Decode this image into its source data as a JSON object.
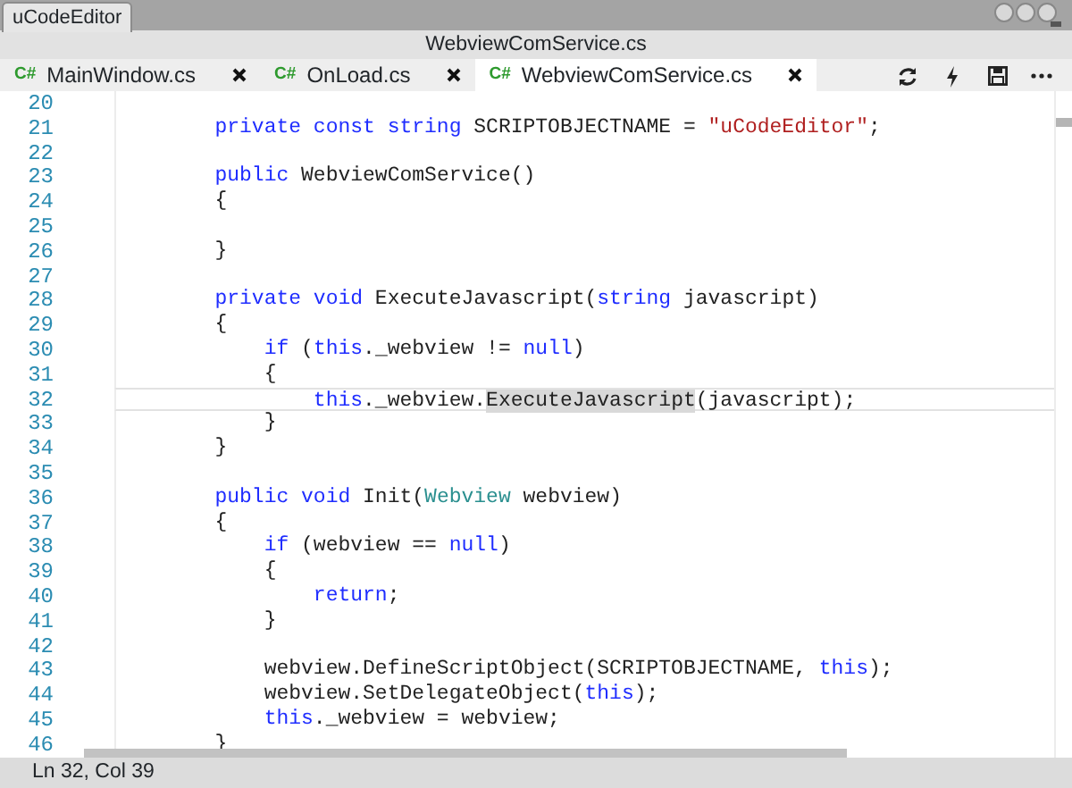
{
  "window": {
    "app_tab": "uCodeEditor",
    "title": "WebviewComService.cs"
  },
  "tabs": [
    {
      "badge": "C#",
      "label": "MainWindow.cs",
      "selected": false
    },
    {
      "badge": "C#",
      "label": "OnLoad.cs",
      "selected": false
    },
    {
      "badge": "C#",
      "label": "WebviewComService.cs",
      "selected": true
    }
  ],
  "editor": {
    "lines": [
      {
        "number": "20",
        "current": false
      },
      {
        "number": "21",
        "current": false,
        "tokens": [
          {
            "kind": "keyword",
            "text": "        private const string"
          },
          {
            "kind": "plain",
            "text": " SCRIPTOBJECTNAME = "
          },
          {
            "kind": "string",
            "text": "\"uCodeEditor\""
          },
          {
            "kind": "plain",
            "text": ";"
          }
        ]
      },
      {
        "number": "22",
        "current": false
      },
      {
        "number": "23",
        "current": false,
        "tokens": [
          {
            "kind": "keyword",
            "text": "        public"
          },
          {
            "kind": "plain",
            "text": " WebviewComService()"
          }
        ]
      },
      {
        "number": "24",
        "current": false,
        "tokens": [
          {
            "kind": "plain",
            "text": "        {"
          }
        ]
      },
      {
        "number": "25",
        "current": false
      },
      {
        "number": "26",
        "current": false,
        "tokens": [
          {
            "kind": "plain",
            "text": "        }"
          }
        ]
      },
      {
        "number": "27",
        "current": false
      },
      {
        "number": "28",
        "current": false,
        "tokens": [
          {
            "kind": "keyword",
            "text": "        private void"
          },
          {
            "kind": "plain",
            "text": " ExecuteJavascript("
          },
          {
            "kind": "keyword",
            "text": "string"
          },
          {
            "kind": "plain",
            "text": " javascript)"
          }
        ]
      },
      {
        "number": "29",
        "current": false,
        "tokens": [
          {
            "kind": "plain",
            "text": "        {"
          }
        ]
      },
      {
        "number": "30",
        "current": false,
        "tokens": [
          {
            "kind": "keyword",
            "text": "            if"
          },
          {
            "kind": "plain",
            "text": " ("
          },
          {
            "kind": "keyword",
            "text": "this"
          },
          {
            "kind": "plain",
            "text": "._webview != "
          },
          {
            "kind": "keyword",
            "text": "null"
          },
          {
            "kind": "plain",
            "text": ")"
          }
        ]
      },
      {
        "number": "31",
        "current": false,
        "tokens": [
          {
            "kind": "plain",
            "text": "            {"
          }
        ]
      },
      {
        "number": "32",
        "current": true,
        "tokens": [
          {
            "kind": "keyword",
            "text": "                this"
          },
          {
            "kind": "plain",
            "text": "._webview."
          },
          {
            "kind": "highlight",
            "text": "ExecuteJavascript"
          },
          {
            "kind": "plain",
            "text": "(javascript);"
          }
        ]
      },
      {
        "number": "33",
        "current": false,
        "tokens": [
          {
            "kind": "plain",
            "text": "            }"
          }
        ]
      },
      {
        "number": "34",
        "current": false,
        "tokens": [
          {
            "kind": "plain",
            "text": "        }"
          }
        ]
      },
      {
        "number": "35",
        "current": false
      },
      {
        "number": "36",
        "current": false,
        "tokens": [
          {
            "kind": "keyword",
            "text": "        public void"
          },
          {
            "kind": "plain",
            "text": " Init("
          },
          {
            "kind": "type",
            "text": "Webview"
          },
          {
            "kind": "plain",
            "text": " webview)"
          }
        ]
      },
      {
        "number": "37",
        "current": false,
        "tokens": [
          {
            "kind": "plain",
            "text": "        {"
          }
        ]
      },
      {
        "number": "38",
        "current": false,
        "tokens": [
          {
            "kind": "keyword",
            "text": "            if"
          },
          {
            "kind": "plain",
            "text": " (webview == "
          },
          {
            "kind": "keyword",
            "text": "null"
          },
          {
            "kind": "plain",
            "text": ")"
          }
        ]
      },
      {
        "number": "39",
        "current": false,
        "tokens": [
          {
            "kind": "plain",
            "text": "            {"
          }
        ]
      },
      {
        "number": "40",
        "current": false,
        "tokens": [
          {
            "kind": "keyword",
            "text": "                return"
          },
          {
            "kind": "plain",
            "text": ";"
          }
        ]
      },
      {
        "number": "41",
        "current": false,
        "tokens": [
          {
            "kind": "plain",
            "text": "            }"
          }
        ]
      },
      {
        "number": "42",
        "current": false
      },
      {
        "number": "43",
        "current": false,
        "tokens": [
          {
            "kind": "plain",
            "text": "            webview.DefineScriptObject(SCRIPTOBJECTNAME, "
          },
          {
            "kind": "keyword",
            "text": "this"
          },
          {
            "kind": "plain",
            "text": ");"
          }
        ]
      },
      {
        "number": "44",
        "current": false,
        "tokens": [
          {
            "kind": "plain",
            "text": "            webview.SetDelegateObject("
          },
          {
            "kind": "keyword",
            "text": "this"
          },
          {
            "kind": "plain",
            "text": ");"
          }
        ]
      },
      {
        "number": "45",
        "current": false,
        "tokens": [
          {
            "kind": "keyword",
            "text": "            this"
          },
          {
            "kind": "plain",
            "text": "._webview = webview;"
          }
        ]
      },
      {
        "number": "46",
        "current": false,
        "tokens": [
          {
            "kind": "plain",
            "text": "        }"
          }
        ]
      }
    ]
  },
  "status_bar": {
    "position": "Ln 32, Col 39"
  }
}
